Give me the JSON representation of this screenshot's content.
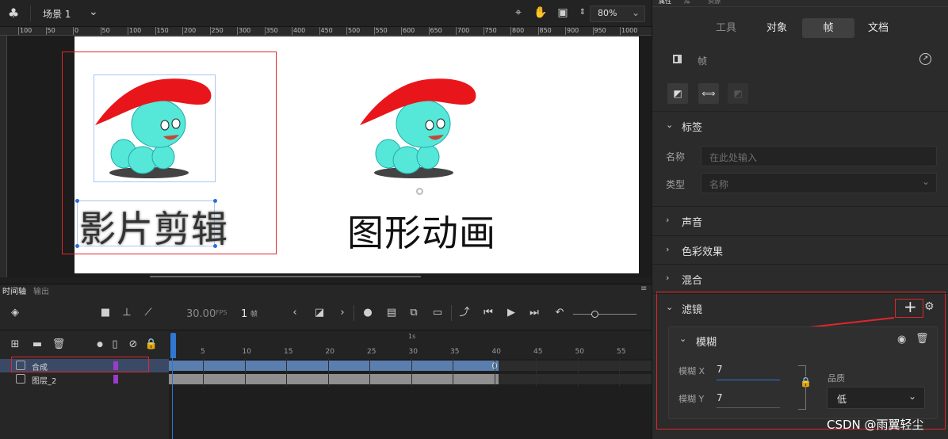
{
  "topbar": {
    "scene_label": "场景 1",
    "zoom_value": "80%",
    "icons": [
      "scene-icon",
      "chevron-down-icon",
      "crosshair-icon",
      "hand-icon",
      "frame-icon",
      "spinner-icon",
      "chevron-down-icon"
    ]
  },
  "ruler": {
    "labels": [
      "100",
      "50",
      "0",
      "50",
      "100",
      "150",
      "200",
      "250",
      "300",
      "350",
      "400",
      "450",
      "500",
      "550",
      "600",
      "650",
      "700",
      "750",
      "800",
      "850",
      "900",
      "950",
      "1000"
    ]
  },
  "stage": {
    "movieclip_text": "影片剪辑",
    "graphic_text": "图形动画"
  },
  "timeline": {
    "tab_timeline": "时间轴",
    "tab_output": "输出",
    "fps_value": "30.00",
    "fps_unit": "FPS",
    "frame_value": "1",
    "frame_unit": "帧",
    "second_marker": "1s",
    "frame_numbers": [
      "5",
      "10",
      "15",
      "20",
      "25",
      "30",
      "35",
      "40",
      "45",
      "50",
      "55"
    ],
    "layers": [
      {
        "name": "合成",
        "selected": true
      },
      {
        "name": "图层_2",
        "selected": false
      }
    ]
  },
  "panel": {
    "top_tabs": [
      "属性",
      "库",
      "资源"
    ],
    "tabs": [
      "工具",
      "对象",
      "帧",
      "文档"
    ],
    "active_tab": "帧",
    "frame_header": "帧",
    "sections": {
      "label": "标签",
      "sound": "声音",
      "color_effect": "色彩效果",
      "blend": "混合",
      "filters": "滤镜"
    },
    "name_label": "名称",
    "name_placeholder": "在此处输入",
    "type_label": "类型",
    "type_value": "名称",
    "blur": {
      "title": "模糊",
      "x_label": "模糊 X",
      "x_value": "7",
      "y_label": "模糊 Y",
      "y_value": "7",
      "quality_label": "品质",
      "quality_value": "低"
    }
  },
  "watermark": "CSDN @雨翼轻尘",
  "colors": {
    "accent_blue": "#2f77d0",
    "highlight_red": "#e0262a",
    "layer_color": "#9b3bc9"
  }
}
